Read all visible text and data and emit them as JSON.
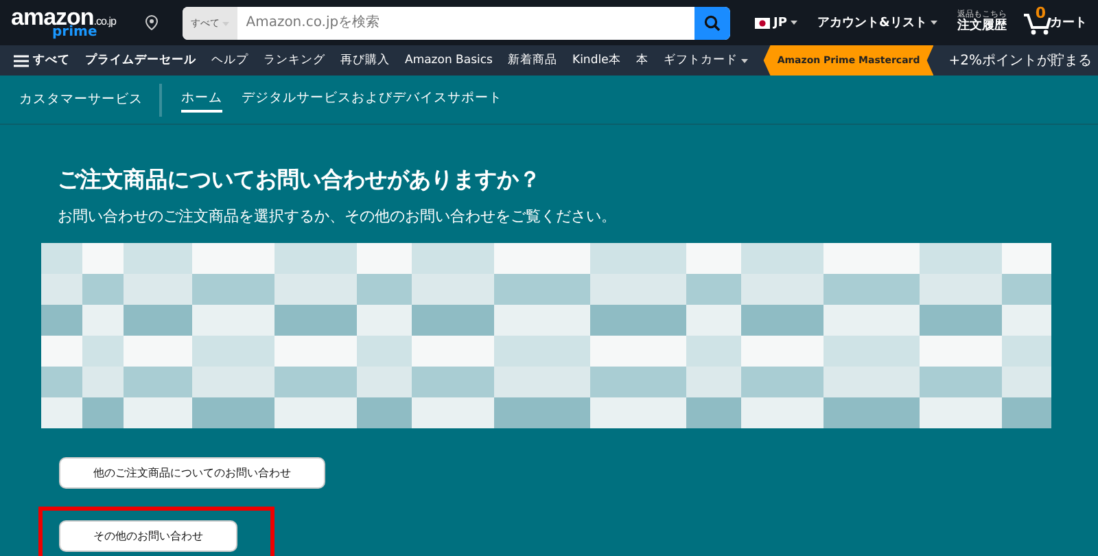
{
  "header": {
    "logo": "amazon",
    "logo_domain": ".co.jp",
    "logo_sub": "prime",
    "search": {
      "category": "すべて",
      "placeholder": "Amazon.co.jpを検索"
    },
    "language": "JP",
    "account": "アカウント&リスト",
    "orders_top": "返品もこちら",
    "orders": "注文履歴",
    "cart_count": "0",
    "cart": "カート"
  },
  "nav": {
    "all": "すべて",
    "items": [
      {
        "label": "プライムデーセール",
        "bold": true
      },
      {
        "label": "ヘルプ",
        "bold": false
      },
      {
        "label": "ランキング",
        "bold": false
      },
      {
        "label": "再び購入",
        "bold": false
      },
      {
        "label": "Amazon Basics",
        "bold": false
      },
      {
        "label": "新着商品",
        "bold": false
      },
      {
        "label": "Kindle本",
        "bold": false
      },
      {
        "label": "本",
        "bold": false
      },
      {
        "label": "ギフトカード",
        "bold": false,
        "dropdown": true
      }
    ],
    "promo": "Amazon Prime Mastercard",
    "promo_text": "+2%ポイントが貯まる"
  },
  "subnav": {
    "title": "カスタマーサービス",
    "tabs": [
      {
        "label": "ホーム",
        "selected": true
      },
      {
        "label": "デジタルサービスおよびデバイスサポート",
        "selected": false
      }
    ]
  },
  "main": {
    "heading": "ご注文商品についてお問い合わせがありますか？",
    "subtitle": "お問い合わせのご注文商品を選択するか、その他のお問い合わせをご覧ください。",
    "buttons": [
      {
        "label": "他のご注文商品についてのお問い合わせ",
        "highlighted": false
      },
      {
        "label": "その他のお問い合わせ",
        "highlighted": true
      }
    ]
  }
}
